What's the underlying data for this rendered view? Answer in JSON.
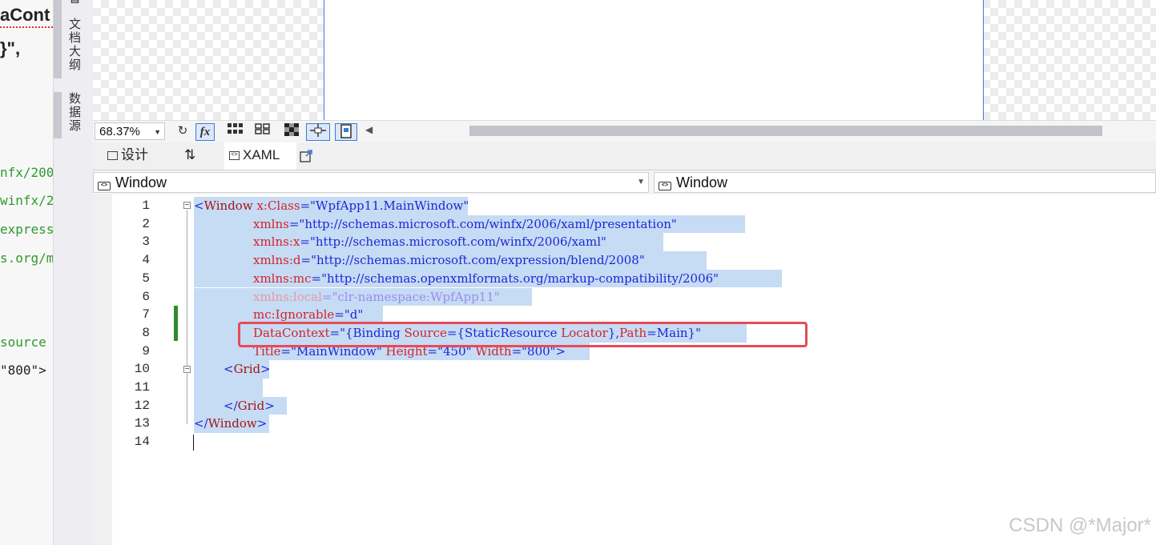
{
  "left_editor": {
    "line1": "aCont",
    "line2": "}\",",
    "code_lines": [
      "nfx/200",
      "winfx/2",
      "express",
      "s.org/m",
      "source",
      "\"800\">"
    ]
  },
  "side_tabs": {
    "doc_outline": "文档大纲",
    "data_sources": "数据源",
    "top_fragment": "督"
  },
  "toolbar": {
    "zoom": "68.37%",
    "refresh_icon": "refresh-icon",
    "fx_label": "fx"
  },
  "view_tabs": {
    "design": "设计",
    "swap": "⇅",
    "xaml": "XAML"
  },
  "nav": {
    "left_selector": "Window",
    "right_selector": "Window"
  },
  "editor": {
    "line_numbers": [
      "1",
      "2",
      "3",
      "4",
      "5",
      "6",
      "7",
      "8",
      "9",
      "10",
      "11",
      "12",
      "13",
      "14"
    ],
    "lines": {
      "l1": [
        {
          "t": "<",
          "c": "t-blue"
        },
        {
          "t": "Window",
          "c": "t-mag"
        },
        {
          "t": " x:Class",
          "c": "t-red"
        },
        {
          "t": "=",
          "c": "t-blue"
        },
        {
          "t": "\"WpfApp11.MainWindow\"",
          "c": "t-blue"
        }
      ],
      "l2": [
        {
          "t": "xmlns",
          "c": "t-red"
        },
        {
          "t": "=",
          "c": "t-blue"
        },
        {
          "t": "\"http://schemas.microsoft.com/winfx/2006/xaml/presentation\"",
          "c": "t-blue"
        }
      ],
      "l3": [
        {
          "t": "xmlns:x",
          "c": "t-red"
        },
        {
          "t": "=",
          "c": "t-blue"
        },
        {
          "t": "\"http://schemas.microsoft.com/winfx/2006/xaml\"",
          "c": "t-blue"
        }
      ],
      "l4": [
        {
          "t": "xmlns:d",
          "c": "t-red"
        },
        {
          "t": "=",
          "c": "t-blue"
        },
        {
          "t": "\"http://schemas.microsoft.com/expression/blend/2008\"",
          "c": "t-blue"
        }
      ],
      "l5": [
        {
          "t": "xmlns:mc",
          "c": "t-red"
        },
        {
          "t": "=",
          "c": "t-blue"
        },
        {
          "t": "\"http://schemas.openxmlformats.org/markup-compatibility/2006\"",
          "c": "t-blue"
        }
      ],
      "l6": [
        {
          "t": "xmlns:local",
          "c": "t-lred"
        },
        {
          "t": "=",
          "c": "t-fade"
        },
        {
          "t": "\"clr-namespace:WpfApp11\"",
          "c": "t-fade"
        }
      ],
      "l7": [
        {
          "t": "mc:Ignorable",
          "c": "t-red"
        },
        {
          "t": "=",
          "c": "t-blue"
        },
        {
          "t": "\"d\"",
          "c": "t-blue"
        }
      ],
      "l8": [
        {
          "t": "DataContext",
          "c": "t-red"
        },
        {
          "t": "=",
          "c": "t-blue"
        },
        {
          "t": "\"{Binding ",
          "c": "t-blue"
        },
        {
          "t": "Source",
          "c": "t-red"
        },
        {
          "t": "={StaticResource ",
          "c": "t-blue"
        },
        {
          "t": "Locator",
          "c": "t-red"
        },
        {
          "t": "},",
          "c": "t-blue"
        },
        {
          "t": "Path",
          "c": "t-red"
        },
        {
          "t": "=Main}\"",
          "c": "t-blue"
        }
      ],
      "l9": [
        {
          "t": "Title",
          "c": "t-red"
        },
        {
          "t": "=\"MainWindow\" ",
          "c": "t-blue"
        },
        {
          "t": "Height",
          "c": "t-red"
        },
        {
          "t": "=\"450\" ",
          "c": "t-blue"
        },
        {
          "t": "Width",
          "c": "t-red"
        },
        {
          "t": "=\"800\">",
          "c": "t-blue"
        }
      ],
      "l10": [
        {
          "t": "<",
          "c": "t-blue"
        },
        {
          "t": "Grid",
          "c": "t-mag"
        },
        {
          "t": ">",
          "c": "t-blue"
        }
      ],
      "l11": [],
      "l12": [
        {
          "t": "</",
          "c": "t-blue"
        },
        {
          "t": "Grid",
          "c": "t-mag"
        },
        {
          "t": ">",
          "c": "t-blue"
        }
      ],
      "l13": [
        {
          "t": "</",
          "c": "t-blue"
        },
        {
          "t": "Window",
          "c": "t-mag"
        },
        {
          "t": ">",
          "c": "t-blue"
        }
      ],
      "l14": []
    }
  },
  "watermark": "CSDN @*Major*"
}
